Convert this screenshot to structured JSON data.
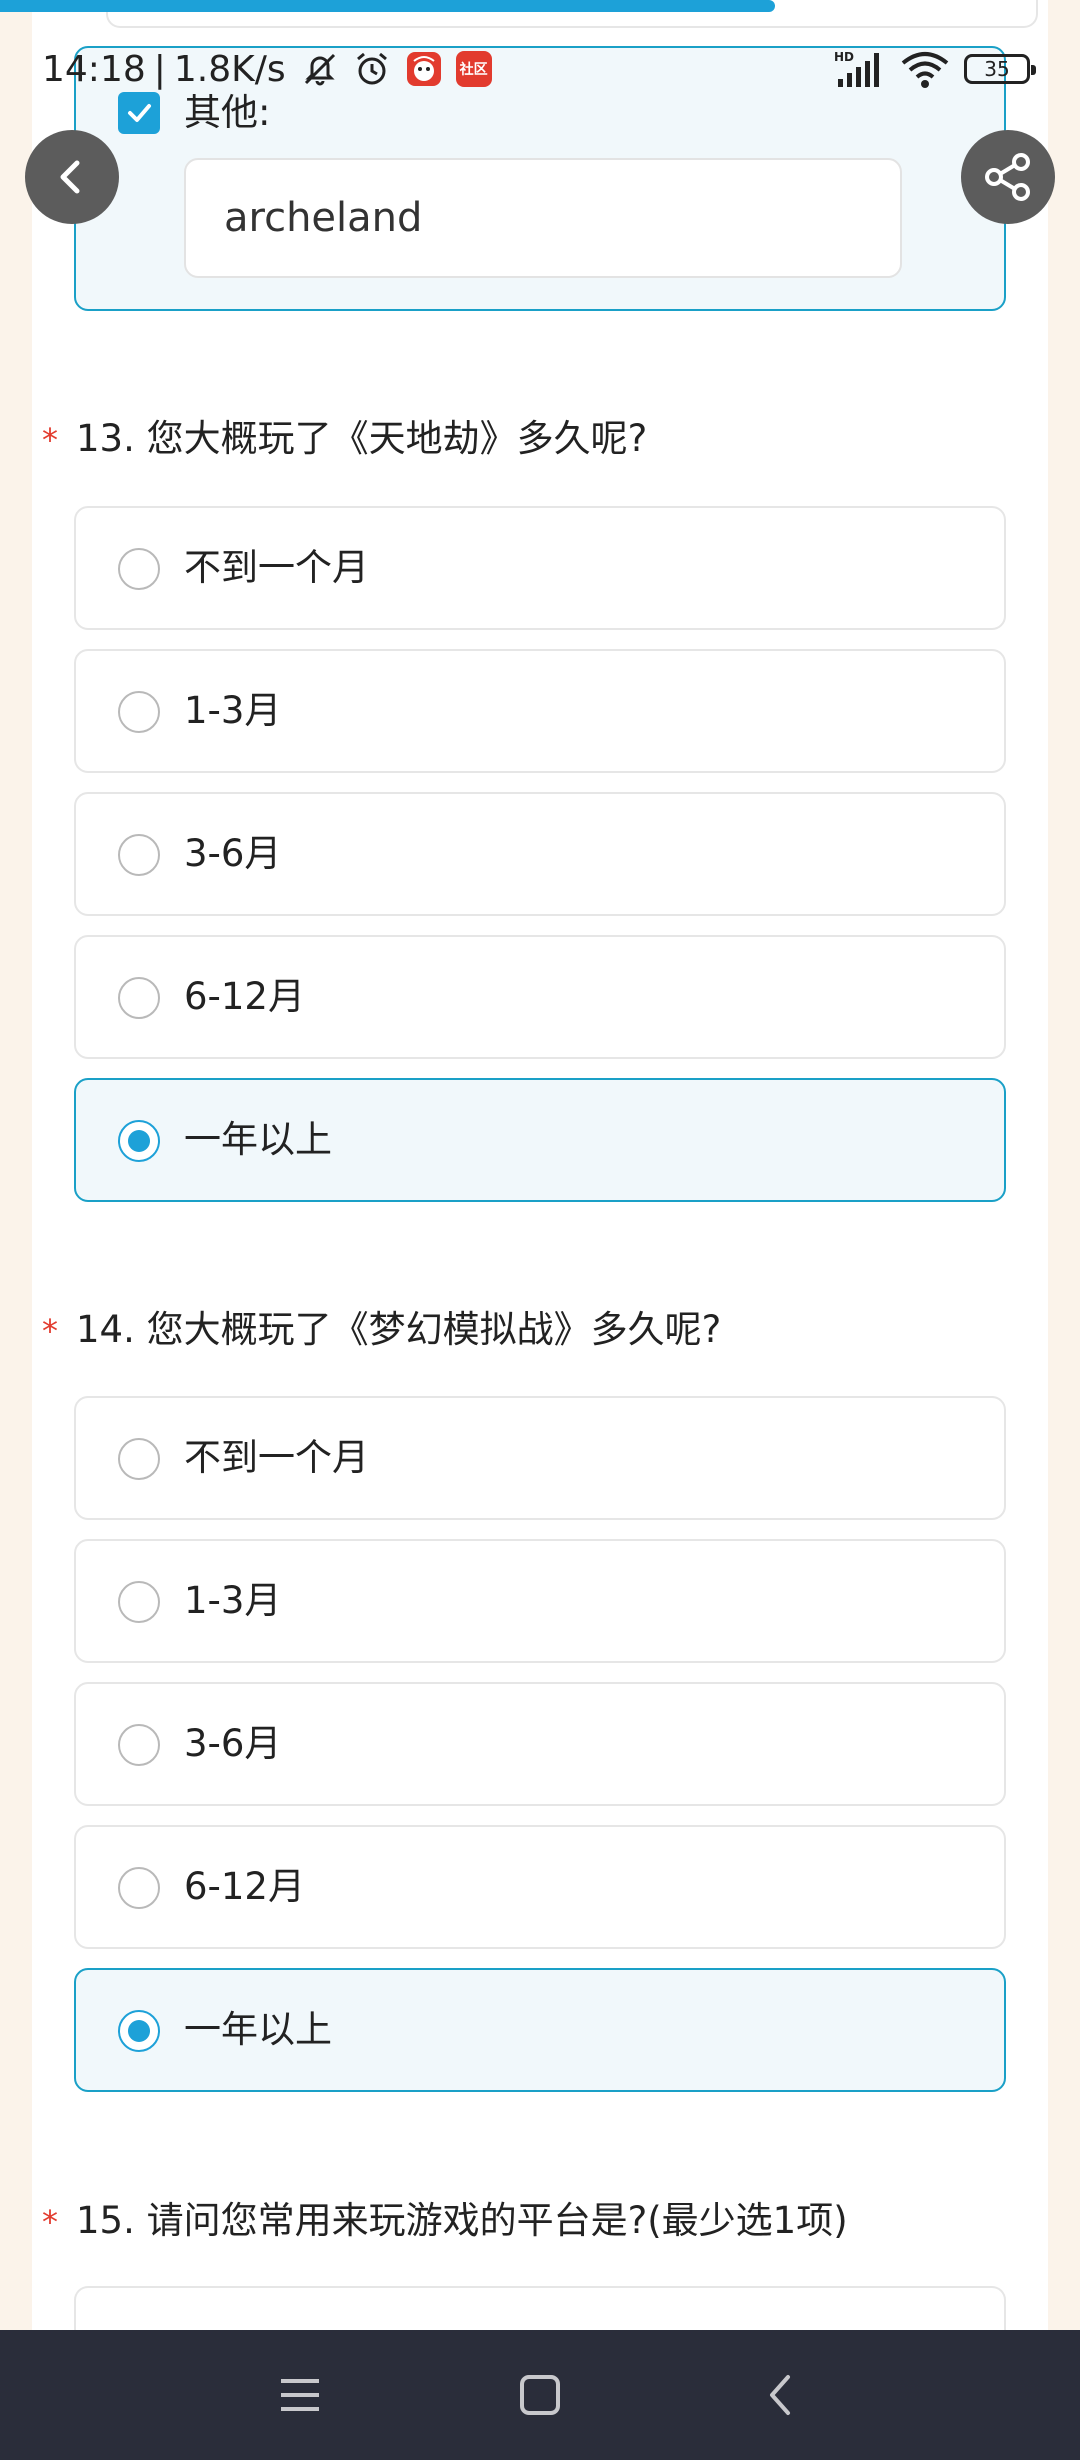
{
  "status_bar": {
    "time": "14:18",
    "net_speed": "1.8K/s",
    "separator": "|",
    "app_badge": "社区",
    "battery": "35",
    "signal_label": "HD"
  },
  "progress": {
    "fraction": 0.7
  },
  "other_option": {
    "label": "其他:",
    "checked": true,
    "value": "archeland"
  },
  "questions": [
    {
      "required_mark": "*",
      "title": "13. 您大概玩了《天地劫》多久呢?",
      "options": [
        "不到一个月",
        "1-3月",
        "3-6月",
        "6-12月",
        "一年以上"
      ],
      "selected": "一年以上"
    },
    {
      "required_mark": "*",
      "title": "14. 您大概玩了《梦幻模拟战》多久呢?",
      "options": [
        "不到一个月",
        "1-3月",
        "3-6月",
        "6-12月",
        "一年以上"
      ],
      "selected": "一年以上"
    },
    {
      "required_mark": "*",
      "title": "15. 请问您常用来玩游戏的平台是?(最少选1项)"
    }
  ],
  "colors": {
    "accent": "#1da1d8",
    "selected_bg": "#f1f8fb",
    "required": "#e23b2e",
    "page_bg": "#fbf3ea",
    "nav_bg": "#2a2d3a"
  }
}
